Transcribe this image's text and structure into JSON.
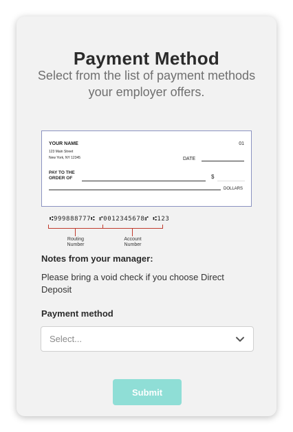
{
  "header": {
    "title": "Payment Method",
    "subtitle": "Select from the list of payment methods your employer offers."
  },
  "check_image": {
    "name": "YOUR NAME",
    "address_line1": "123 Main Street",
    "address_line2": "New York, NY 12345",
    "check_number": "01",
    "date_label": "DATE",
    "pay_to": "PAY TO THE ORDER OF",
    "dollar_sign": "$",
    "dollars_label": "DOLLARS",
    "routing_micr": "⑆999888777⑆",
    "account_micr": "⑈0012345678⑈",
    "check_micr": "⑆123",
    "routing_label": "Routing Number",
    "account_label": "Account Number"
  },
  "notes": {
    "heading": "Notes from your manager:",
    "text": "Please bring a void check if you choose Direct Deposit"
  },
  "payment_method": {
    "label": "Payment method",
    "selected": "Select..."
  },
  "actions": {
    "submit_label": "Submit"
  },
  "colors": {
    "submit_bg": "#8fded6",
    "check_border": "#8a92c0",
    "bracket": "#c0392b"
  }
}
